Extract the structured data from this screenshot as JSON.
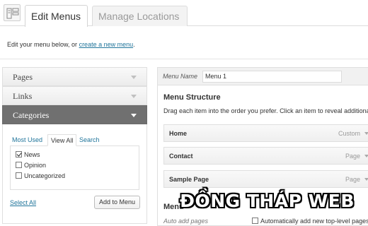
{
  "tabs": [
    {
      "label": "Edit Menus",
      "active": true
    },
    {
      "label": "Manage Locations",
      "active": false
    }
  ],
  "intro": {
    "text": "Edit your menu below, or ",
    "link": "create a new menu",
    "suffix": "."
  },
  "sidebar": {
    "sections": [
      {
        "label": "Pages",
        "open": false
      },
      {
        "label": "Links",
        "open": false
      },
      {
        "label": "Categories",
        "open": true
      }
    ],
    "subtabs": [
      "Most Used",
      "View All",
      "Search"
    ],
    "active_subtab": "View All",
    "items": [
      {
        "label": "News",
        "checked": true
      },
      {
        "label": "Opinion",
        "checked": false
      },
      {
        "label": "Uncategorized",
        "checked": false
      }
    ],
    "select_all": "Select All",
    "add_button": "Add to Menu"
  },
  "editor": {
    "name_label": "Menu Name",
    "name_value": "Menu 1",
    "structure_title": "Menu Structure",
    "structure_desc": "Drag each item into the order you prefer. Click an item to reveal additional",
    "items": [
      {
        "title": "Home",
        "type": "Custom"
      },
      {
        "title": "Contact",
        "type": "Page"
      },
      {
        "title": "Sample Page",
        "type": "Page"
      }
    ],
    "settings_title": "Menu",
    "auto_add_label": "Auto add pages",
    "auto_add_check": "Automatically add new top-level pages"
  },
  "watermark": "ĐỒNG THÁP WEB",
  "colors": {
    "link": "#21759b",
    "open_section_bg": "#707070"
  }
}
